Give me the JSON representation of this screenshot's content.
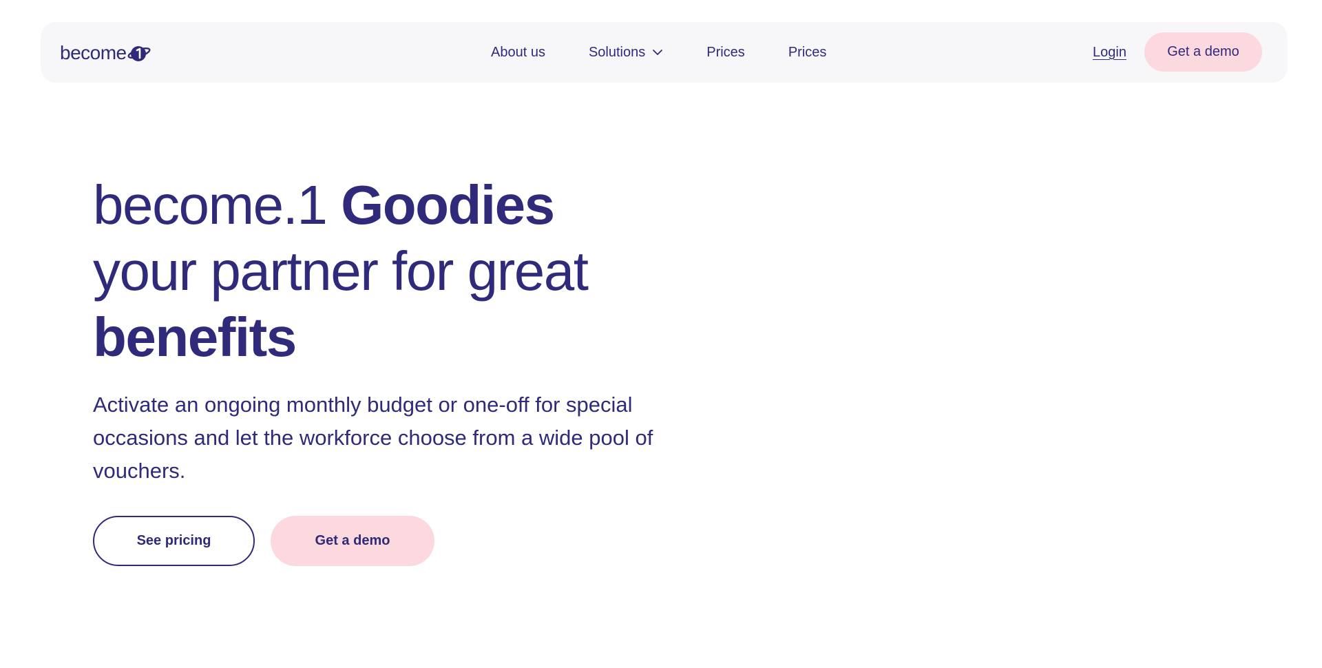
{
  "brand": {
    "logo_text": "become",
    "logo_mark_icon": "planet-one-icon",
    "primary_color": "#2f2a7a",
    "accent_color": "#fcd8df"
  },
  "nav": {
    "links": [
      "About us",
      "Solutions",
      "Prices",
      "Prices"
    ],
    "solutions_dropdown_icon": "chevron-down-icon",
    "login": "Login",
    "cta": "Get a demo"
  },
  "hero": {
    "title_light_1": "become.1 ",
    "title_bold_1": "Goodies",
    "title_light_2": "your partner for great",
    "title_bold_2": "benefits",
    "description": "Activate an ongoing monthly budget or one-off for special occasions and let the workforce choose from a wide pool of vouchers.",
    "buttons": {
      "secondary": "See pricing",
      "primary": "Get a demo"
    }
  }
}
